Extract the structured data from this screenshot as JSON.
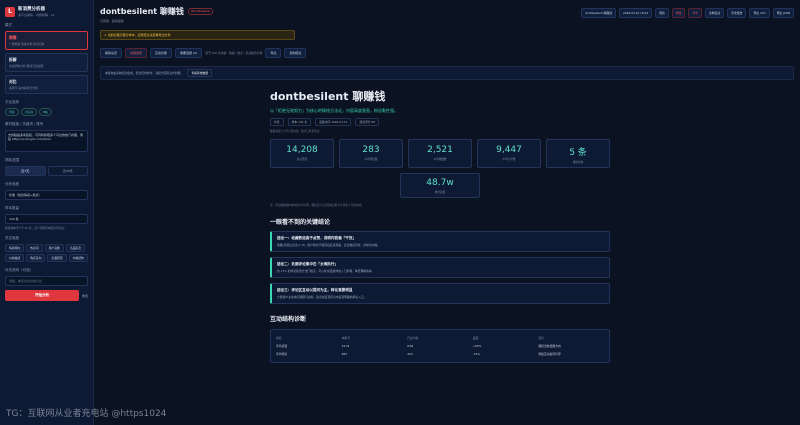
{
  "sidebar": {
    "logo_letter": "L",
    "title": "新消费分析器",
    "subtitle": "多平台舆情 · 内容拆解 · v2",
    "mode_section": "模式",
    "modes": [
      {
        "name": "舆情",
        "desc": "一键抓取·情感分析·热点归纳"
      },
      {
        "name": "拆解",
        "desc": "文案结构分析·爆款元素提取"
      },
      {
        "name": "对比",
        "desc": "多账号·多内容对比分析"
      }
    ],
    "platform_section": "平台选择",
    "platforms": [
      "抖音",
      "小红书",
      "B站"
    ],
    "input_section": "素材链接 / 关键词 / 账号",
    "input_value": "支持粘贴多条链接，可同时抓取多个平台的热门内容，例如 https://v.douyin.com/xxxx",
    "range_section": "抓取范围",
    "range_options": [
      "近7天",
      "近30天"
    ],
    "depth_section": "分析深度",
    "depth_value": "标准（综合情感+热点）",
    "count_section": "样本数量",
    "count_value": "100 条",
    "note": "建议样本不少于 50 条，过少可能影响结论可信度。",
    "focus_section": "关注维度",
    "focus_chips": [
      "情感倾向",
      "热点词",
      "用户画像",
      "竞品提及",
      "价格敏感",
      "购买意向",
      "负面原因",
      "内容结构"
    ],
    "extra_section": "补充说明（可选）",
    "extra_placeholder": "例如：重点关注价格讨论",
    "start_label": "开始分析",
    "reset_label": "重置"
  },
  "header": {
    "title": "dontbesilent 聊赚钱",
    "live_tag": "@dontbesilent",
    "subtitle": "已抓取 · 舆情报告",
    "buttons": [
      "dontbesilent 聊赚钱",
      "2026-03-10 16:22",
      "刷新",
      "导出",
      "分享",
      "复制链接",
      "历史报告",
      "导出 CSV",
      "导出 JSON"
    ]
  },
  "alert": "⚠ 当前仅展示部分样本，完整结论请查看导出文件",
  "toolbar": {
    "buttons": [
      "舆情总览",
      "关键发现",
      "互动诊断",
      "重要话题 (5)",
      "导出"
    ],
    "hint": "基于 100 条内容 · 情感 / 热点 / 互动综合分析",
    "right_button": "复制结论"
  },
  "banner": {
    "text": "本报告由系统自动生成，结论仅供参考，请结合实际业务判断。",
    "button": "查看原始数据"
  },
  "report": {
    "title": "dontbesilent 聊赚钱",
    "lead": "以「拒绝无效努力」为核心的搞钱方法论，内容高度垂直，粉丝黏性强。",
    "meta": [
      "抖音",
      "样本 100 条",
      "采集时间 2026-03-10",
      "综合评分 86"
    ],
    "small_note": "数据来源于公开可见内容，统计口径见附录。",
    "stats": [
      {
        "value": "14,208",
        "label": "总点赞量"
      },
      {
        "value": "283",
        "label": "平均评论数"
      },
      {
        "value": "2,521",
        "label": "平均收藏数"
      },
      {
        "value": "9,447",
        "label": "平均分享数"
      },
      {
        "value": "5 条",
        "label": "爆款内容"
      }
    ],
    "big_stat": {
      "value": "48.7w",
      "label": "粉丝总量"
    },
    "foot_note": "注：互动数据按样本内容平均计算，爆款定义为点赞超过账号平均值 3 倍的内容。",
    "section_findings": "一眼看不到的关键结论",
    "findings": [
      {
        "title": "结论一：收藏数远高于点赞，说明内容偏「干货」",
        "body": "收藏/点赞比高达 0.18，用户倾向于保存后反复观看，适合做系列化、清单式内容。"
      },
      {
        "title": "结论二：负面评论集中在「太难执行」",
        "body": "约 12% 的评论提到方法门槛高，可以补充更具体的入门步骤，降低理解成本。"
      },
      {
        "title": "结论三：评论区互动以提问为主，转化意愿明显",
        "body": "大量用户主动询问课程与资料，建议在置顶评论中设置明确的承接入口。"
      }
    ],
    "section_table": "互动结构诊断",
    "table_headers": [
      "指标",
      "本账号",
      "行业均值",
      "差距",
      "建议"
    ],
    "table_rows": [
      [
        "平均点赞",
        "14.2k",
        "8.6k",
        "+65%",
        "保持当前选题方向"
      ],
      [
        "平均评论",
        "283",
        "410",
        "-31%",
        "增加互动提问引导"
      ]
    ]
  },
  "watermark": "TG：互联网从业者充电站 @https1024"
}
